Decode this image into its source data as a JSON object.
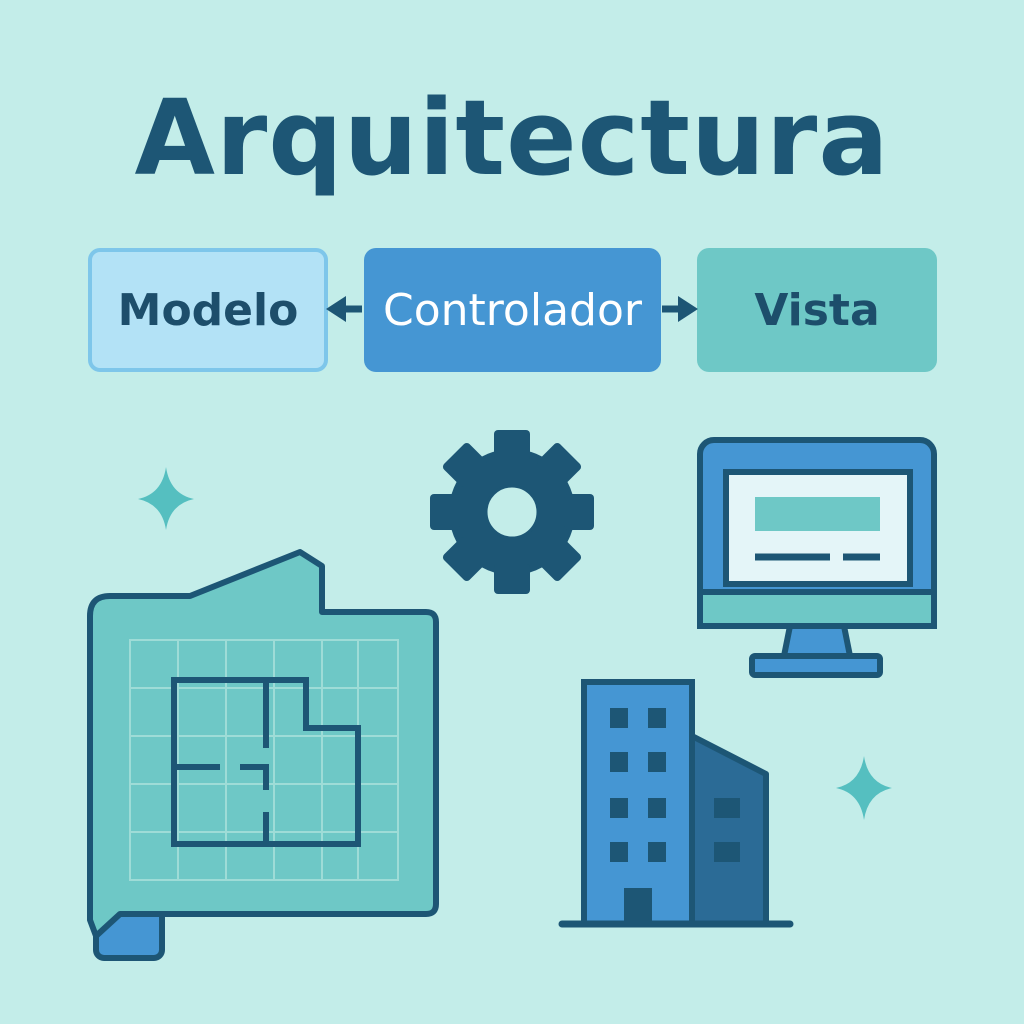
{
  "title": "Arquitectura",
  "components": {
    "model": "Modelo",
    "controller": "Controlador",
    "view": "Vista"
  },
  "colors": {
    "background": "#c3ede9",
    "title": "#1d5675",
    "model_fill": "#b3e2f6",
    "controller_fill": "#4596d3",
    "view_fill": "#6ec8c6",
    "outline": "#1d5675"
  },
  "icons": [
    "sparkle-icon",
    "gear-icon",
    "monitor-icon",
    "blueprint-icon",
    "building-icon"
  ]
}
